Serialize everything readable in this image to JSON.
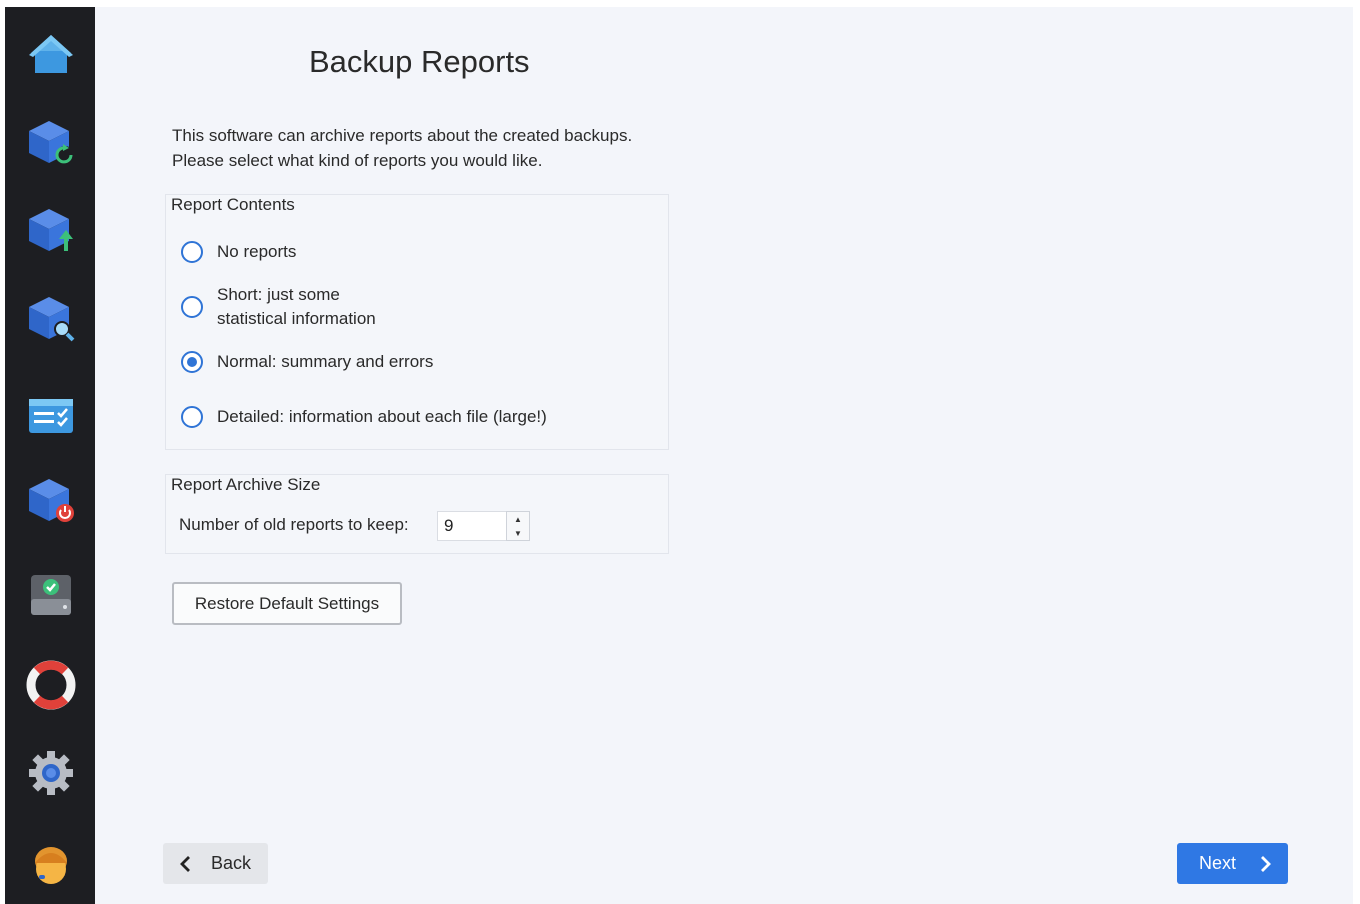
{
  "page": {
    "title": "Backup Reports",
    "intro_line1": "This software can archive reports about the created backups.",
    "intro_line2": "Please select what kind of reports you would like."
  },
  "sidebar": {
    "items": [
      {
        "icon": "home-icon"
      },
      {
        "icon": "backup-refresh-icon"
      },
      {
        "icon": "backup-upload-icon"
      },
      {
        "icon": "backup-search-icon"
      },
      {
        "icon": "task-list-icon"
      },
      {
        "icon": "backup-power-icon"
      },
      {
        "icon": "drive-check-icon"
      },
      {
        "icon": "lifebuoy-icon"
      },
      {
        "icon": "settings-gear-icon"
      },
      {
        "icon": "support-agent-icon"
      }
    ]
  },
  "report_contents": {
    "title": "Report Contents",
    "options": [
      {
        "line1": "No reports",
        "line2": "",
        "checked": false
      },
      {
        "line1": "Short: just some",
        "line2": "statistical information",
        "checked": false
      },
      {
        "line1": "Normal: summary and errors",
        "line2": "",
        "checked": true
      },
      {
        "line1": "Detailed: information about each file (large!)",
        "line2": "",
        "checked": false
      }
    ]
  },
  "archive_size": {
    "title": "Report Archive Size",
    "label": "Number of old reports to keep:",
    "value": "9"
  },
  "buttons": {
    "restore": "Restore Default Settings",
    "back": "Back",
    "next": "Next"
  },
  "colors": {
    "sidebar_bg": "#1d1e22",
    "accent": "#2f78e4",
    "radio": "#2f74d6",
    "page_bg": "#f3f5fa"
  }
}
